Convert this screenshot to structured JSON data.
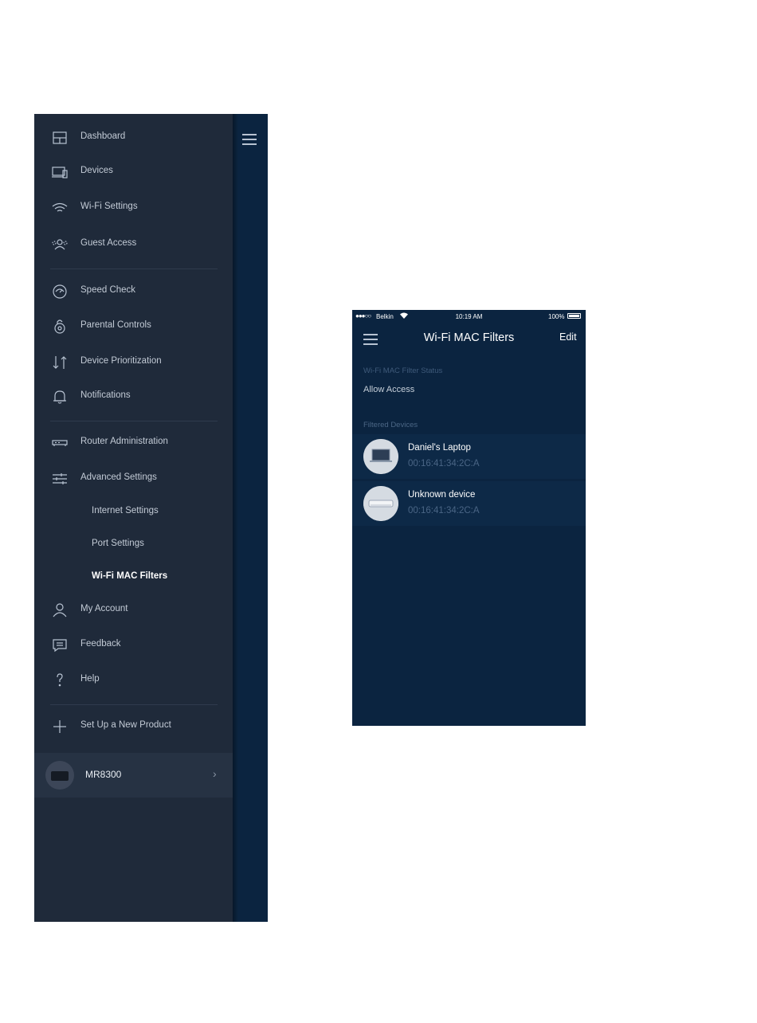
{
  "drawer": {
    "menu_icon": "hamburger-icon",
    "items": [
      {
        "label": "Dashboard",
        "icon": "dashboard-icon"
      },
      {
        "label": "Devices",
        "icon": "devices-icon"
      },
      {
        "label": "Wi-Fi Settings",
        "icon": "wifi-icon"
      },
      {
        "label": "Guest Access",
        "icon": "guest-access-icon"
      },
      {
        "label": "Speed Check",
        "icon": "speedometer-icon"
      },
      {
        "label": "Parental Controls",
        "icon": "lock-icon"
      },
      {
        "label": "Device Prioritization",
        "icon": "up-down-arrows-icon"
      },
      {
        "label": "Notifications",
        "icon": "bell-icon"
      },
      {
        "label": "Router Administration",
        "icon": "router-icon"
      },
      {
        "label": "Advanced Settings",
        "icon": "sliders-icon"
      },
      {
        "label": "My Account",
        "icon": "user-icon"
      },
      {
        "label": "Feedback",
        "icon": "chat-icon"
      },
      {
        "label": "Help",
        "icon": "question-icon"
      },
      {
        "label": "Set Up a New Product",
        "icon": "plus-icon"
      }
    ],
    "sub_items": [
      {
        "label": "Internet Settings",
        "active": false
      },
      {
        "label": "Port Settings",
        "active": false
      },
      {
        "label": "Wi-Fi MAC Filters",
        "active": true
      }
    ],
    "product": {
      "name": "MR8300",
      "chevron": "›"
    }
  },
  "mac_filters": {
    "status_bar": {
      "signal": "●●●○○",
      "carrier": "Belkin",
      "time": "10:19 AM",
      "battery": "100%"
    },
    "title": "Wi-Fi MAC Filters",
    "edit_label": "Edit",
    "status_label": "Wi-Fi MAC Filter Status",
    "status_value": "Allow Access",
    "filtered_label": "Filtered Devices",
    "devices": [
      {
        "name": "Daniel's Laptop",
        "mac": "00:16:41:34:2C:A",
        "icon": "laptop-icon"
      },
      {
        "name": "Unknown device",
        "mac": "00:16:41:34:2C:A",
        "icon": "unknown-device-icon"
      }
    ]
  },
  "colors": {
    "drawer_bg": "#1f2a3a",
    "screen_bg": "#0b2440",
    "device_row_bg": "#0d2947",
    "muted_text": "#4a6585"
  }
}
